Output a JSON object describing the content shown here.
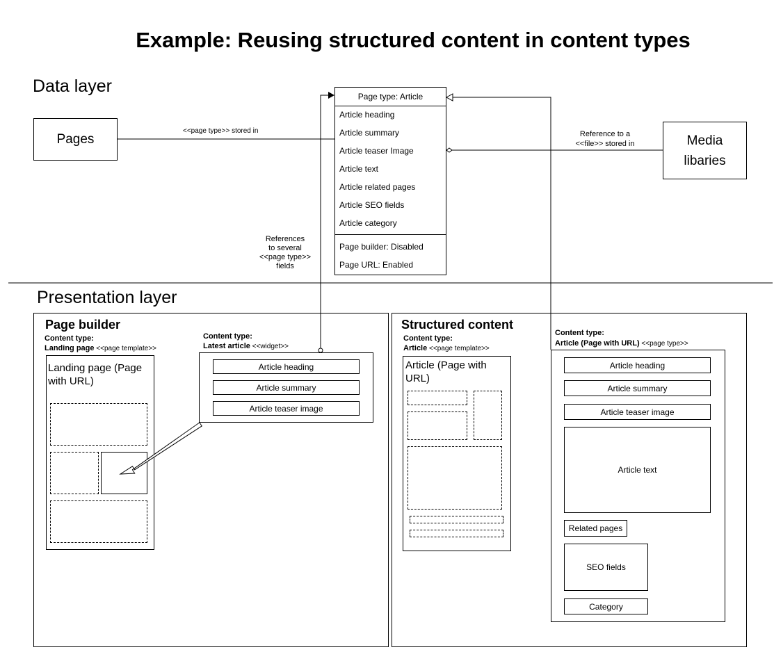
{
  "title": "Example: Reusing structured content in content types",
  "layers": {
    "data": "Data layer",
    "presentation": "Presentation layer"
  },
  "data_layer": {
    "pages": "Pages",
    "media_line1": "Media",
    "media_line2": "libaries",
    "pages_edge_label": "<<page type>> stored in",
    "media_edge_line1": "Reference to a",
    "media_edge_line2": "<<file>> stored in",
    "refs_label": [
      "References",
      "to several",
      "<<page type>>",
      "fields"
    ],
    "article_type": {
      "header": "Page type: Article",
      "fields": [
        "Article heading",
        "Article summary",
        "Article teaser Image",
        "Article text",
        "Article related pages",
        "Article SEO fields",
        "Article category"
      ],
      "settings": [
        "Page builder: Disabled",
        "Page URL: Enabled"
      ]
    }
  },
  "page_builder": {
    "title": "Page builder",
    "ct_label": "Content type:",
    "ct_name": "Landing page",
    "ct_stereotype": " <<page template>>",
    "landing_text": "Landing page (Page with URL)",
    "widget_ct_label": "Content type:",
    "widget_ct_name": "Latest article",
    "widget_ct_stereotype": " <<widget>>",
    "widget_fields": [
      "Article heading",
      "Article summary",
      "Article teaser image"
    ]
  },
  "structured": {
    "title": "Structured content",
    "ct_label": "Content type:",
    "ct_name": "Article",
    "ct_stereotype": " <<page template>>",
    "article_text": "Article (Page with URL)",
    "pt_ct_label": "Content type:",
    "pt_ct_name": "Article (Page with URL)",
    "pt_ct_stereotype": " <<page type>>",
    "fields": {
      "heading": "Article heading",
      "summary": "Article summary",
      "teaser": "Article teaser image",
      "text": "Article text",
      "related": "Related pages",
      "seo": "SEO fields",
      "category": "Category"
    }
  }
}
